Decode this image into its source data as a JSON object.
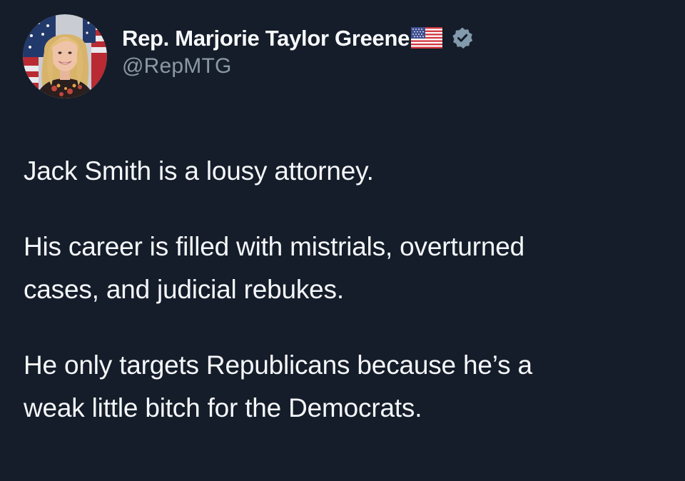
{
  "author": {
    "display_name": "Rep. Marjorie Taylor Greene",
    "handle": "@RepMTG",
    "flag_icon": "us-flag-icon",
    "verified_icon": "verified-badge-icon",
    "badge_color": "#829aab"
  },
  "tweet": {
    "paragraphs": [
      "Jack Smith is a lousy attorney.",
      "His career is filled with mistrials, overturned\ncases, and judicial rebukes.",
      "He only targets Republicans because he’s a\nweak little bitch for the Democrats."
    ]
  },
  "theme": {
    "background": "#151d2a",
    "text": "#f5f7fa",
    "muted_text": "#8b98a5"
  }
}
